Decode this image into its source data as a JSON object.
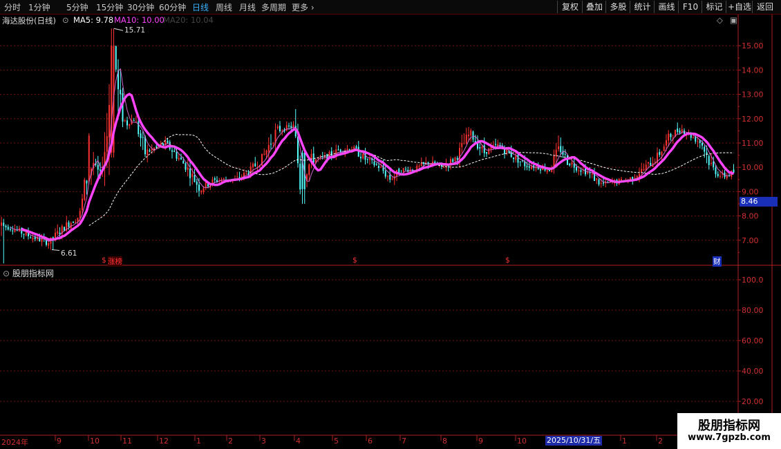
{
  "toolbar": {
    "period_tabs": [
      "分时",
      "1分钟",
      "5分钟",
      "15分钟",
      "30分钟",
      "60分钟",
      "日线",
      "周线",
      "月线",
      "多周期",
      "更多"
    ],
    "active_tab": "日线",
    "right_buttons": [
      "复权",
      "叠加",
      "多股",
      "统计",
      "画线",
      "F10",
      "标记",
      "+自选",
      "返回"
    ]
  },
  "main_chart": {
    "stock_title": "海达股份(日线)",
    "ma5_text": "MA5: 9.78",
    "ma10_text": "MA10: 10.00",
    "ma20_text": "MA20: 10.04",
    "high_label": "15.71",
    "low_label": "6.61",
    "current_price": "8.46",
    "y_ticks": [
      "15.00",
      "14.00",
      "13.00",
      "12.00",
      "11.00",
      "10.00",
      "9.00",
      "8.00",
      "7.00"
    ],
    "markers": [
      "$",
      "涨榜",
      "$",
      "$",
      "财"
    ]
  },
  "sub_chart": {
    "title": "股朋指标网",
    "y_ticks": [
      "100.0",
      "80.00",
      "60.00",
      "40.00",
      "20.00"
    ]
  },
  "x_axis": {
    "labels": [
      "2024年",
      "9",
      "10",
      "11",
      "12",
      "1",
      "2",
      "3",
      "4",
      "5",
      "6",
      "7",
      "8",
      "9",
      "10",
      "2025/10/31/五",
      "1",
      "2"
    ]
  },
  "watermark": {
    "name": "股朋指标网",
    "url": "www.7gpzb.com"
  },
  "colors": {
    "up": "#ff3232",
    "down": "#54ffff",
    "ma5": "#ffffff",
    "ma10": "#ff44ff",
    "ma20": "#ffffff",
    "active": "#39b0ff",
    "axis": "#d23030"
  },
  "chart_data": {
    "type": "candlestick",
    "title": "海达股份(日线)",
    "ylim": [
      6.0,
      16.0
    ],
    "series_ma": [
      {
        "name": "MA5",
        "last": 9.78
      },
      {
        "name": "MA10",
        "last": 10.0
      },
      {
        "name": "MA20",
        "last": 10.04
      }
    ],
    "anchors": [
      [
        0,
        7.6
      ],
      [
        18,
        7.5
      ],
      [
        40,
        7.2
      ],
      [
        70,
        6.9
      ],
      [
        95,
        7.6
      ],
      [
        115,
        8.0
      ],
      [
        125,
        9.5
      ],
      [
        135,
        10.2
      ],
      [
        145,
        9.6
      ],
      [
        155,
        11.4
      ],
      [
        160,
        13.8
      ],
      [
        165,
        15.0
      ],
      [
        172,
        12.5
      ],
      [
        182,
        11.8
      ],
      [
        195,
        12.0
      ],
      [
        210,
        10.6
      ],
      [
        225,
        10.8
      ],
      [
        240,
        11.0
      ],
      [
        255,
        10.5
      ],
      [
        270,
        10.0
      ],
      [
        290,
        9.1
      ],
      [
        305,
        9.4
      ],
      [
        320,
        9.5
      ],
      [
        340,
        9.5
      ],
      [
        360,
        9.8
      ],
      [
        380,
        10.4
      ],
      [
        400,
        11.5
      ],
      [
        425,
        11.7
      ],
      [
        435,
        9.3
      ],
      [
        450,
        10.3
      ],
      [
        470,
        10.4
      ],
      [
        490,
        10.7
      ],
      [
        510,
        10.8
      ],
      [
        530,
        10.3
      ],
      [
        550,
        10.0
      ],
      [
        565,
        9.5
      ],
      [
        580,
        9.9
      ],
      [
        600,
        9.9
      ],
      [
        620,
        10.2
      ],
      [
        640,
        10.0
      ],
      [
        660,
        10.4
      ],
      [
        680,
        11.4
      ],
      [
        700,
        10.6
      ],
      [
        720,
        10.9
      ],
      [
        740,
        10.5
      ],
      [
        760,
        10.1
      ],
      [
        780,
        10.0
      ],
      [
        795,
        9.9
      ],
      [
        810,
        10.8
      ],
      [
        820,
        10.3
      ],
      [
        835,
        10.0
      ],
      [
        850,
        9.8
      ],
      [
        870,
        9.3
      ],
      [
        890,
        9.4
      ],
      [
        910,
        9.5
      ],
      [
        930,
        9.9
      ],
      [
        950,
        10.4
      ],
      [
        970,
        11.3
      ],
      [
        985,
        11.6
      ],
      [
        1000,
        11.3
      ],
      [
        1015,
        11.0
      ],
      [
        1030,
        10.0
      ],
      [
        1045,
        9.6
      ],
      [
        1062,
        9.8
      ]
    ]
  }
}
